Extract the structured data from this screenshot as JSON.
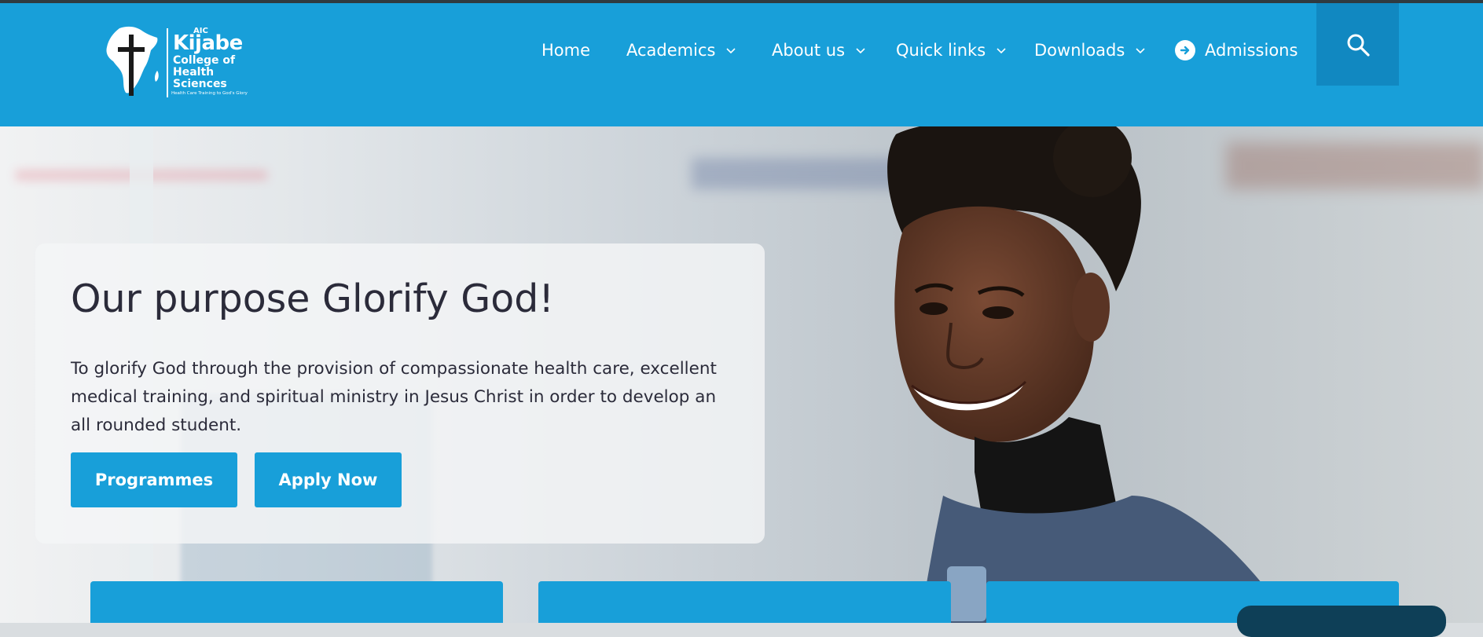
{
  "header": {
    "logo": {
      "aic": "AIC",
      "name": "Kijabe",
      "subtitle": "College of Health Sciences",
      "tagline": "Health Care Training to God's Glory"
    },
    "nav": [
      {
        "label": "Home",
        "dropdown": false
      },
      {
        "label": "Academics",
        "dropdown": true
      },
      {
        "label": "About us",
        "dropdown": true
      },
      {
        "label": "Quick links",
        "dropdown": true
      },
      {
        "label": "Downloads",
        "dropdown": true
      },
      {
        "label": "Admissions",
        "icon": "arrow-circle-right-icon"
      }
    ],
    "search_icon": "search-icon"
  },
  "hero": {
    "title": "Our purpose Glorify God!",
    "body": "To glorify God through the provision of compassionate health care, excellent medical training, and spiritual ministry in Jesus Christ in order to develop an all rounded student.",
    "buttons": {
      "programmes": "Programmes",
      "apply": "Apply Now"
    }
  },
  "colors": {
    "brand": "#189fd9",
    "search_bg": "#1188c1",
    "text_dark": "#2b2b3a",
    "chat": "#0e3f57"
  }
}
